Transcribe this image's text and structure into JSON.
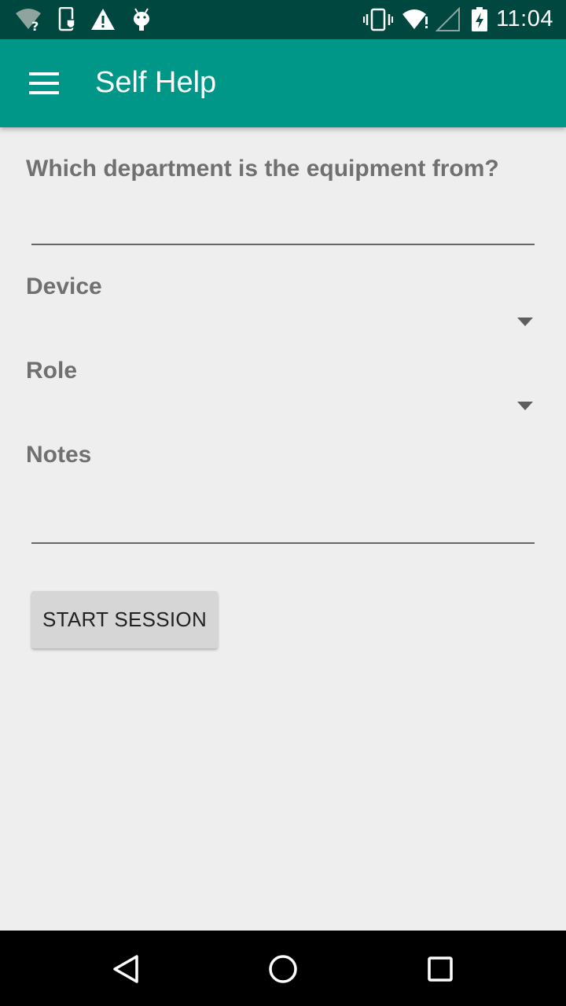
{
  "status_bar": {
    "time": "11:04",
    "icons_left": [
      "wifi-question-icon",
      "phone-shield-icon",
      "warning-icon",
      "android-debug-icon"
    ],
    "icons_right": [
      "vibrate-icon",
      "wifi-alert-icon",
      "signal-empty-icon",
      "battery-charging-icon"
    ]
  },
  "app_bar": {
    "title": "Self Help",
    "menu_icon": "hamburger-menu-icon",
    "color": "#009688"
  },
  "form": {
    "department": {
      "label": "Which department is the equipment from?",
      "value": ""
    },
    "device": {
      "label": "Device",
      "value": ""
    },
    "role": {
      "label": "Role",
      "value": ""
    },
    "notes": {
      "label": "Notes",
      "value": ""
    },
    "start_button": "START SESSION"
  },
  "nav_bar": {
    "back_icon": "back-triangle-icon",
    "home_icon": "home-circle-icon",
    "recents_icon": "recents-square-icon"
  }
}
